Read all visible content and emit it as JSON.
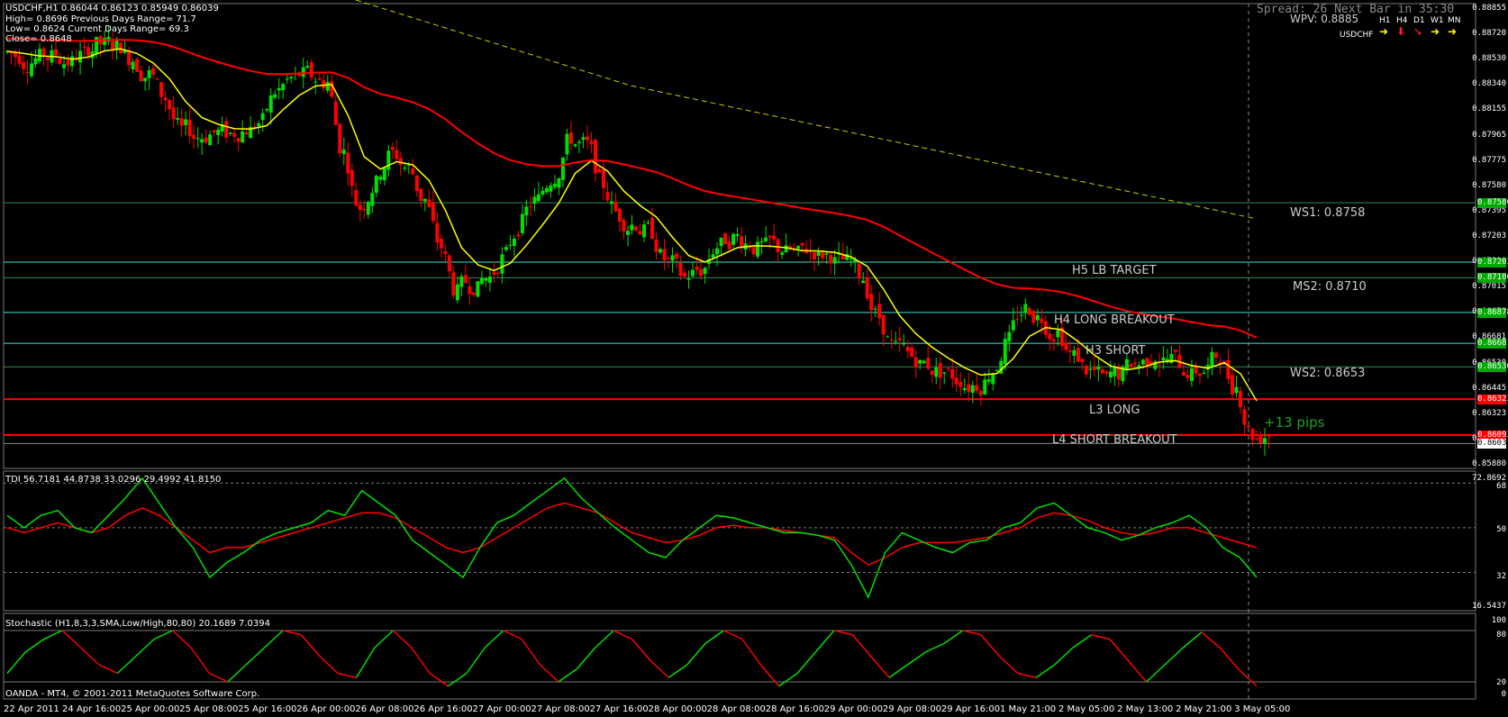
{
  "main": {
    "symbol_line": "USDCHF,H1  0.86044 0.86123 0.85949 0.86039",
    "info_lines": [
      "High= 0.8696   Previous Days Range= 71.7",
      "Low= 0.8624    Current Days Range= 69.3",
      "Close= 0.8648"
    ],
    "spread_text": "Spread: 26   Next Bar in 35:30",
    "wpv": "WPV: 0.8885",
    "tf_labels": [
      "H1",
      "H4",
      "D1",
      "W1",
      "MN"
    ],
    "tf_symbol": "USDCHF",
    "tf_arrows": [
      {
        "glyph": "➜",
        "color": "#ffff00"
      },
      {
        "glyph": "⬇",
        "color": "#ff2020"
      },
      {
        "glyph": "➘",
        "color": "#ff2020"
      },
      {
        "glyph": "➜",
        "color": "#ffff00"
      },
      {
        "glyph": "➜",
        "color": "#ffff00"
      }
    ],
    "price_axis": [
      "0.88855",
      "0.88720",
      "0.88530",
      "0.88340",
      "0.88155",
      "0.87965",
      "0.87775",
      "0.87580",
      "0.87395",
      "0.87203",
      "0.87100",
      "0.87015",
      "0.86878",
      "0.86681",
      "0.86530",
      "0.86445",
      "0.86323",
      "0.86039",
      "0.85880"
    ],
    "level_lines": [
      {
        "name": "WS1",
        "price": 0.8758,
        "color": "#2e8b57",
        "tag": "0.87580",
        "tag_color": "#00aa00"
      },
      {
        "name": "H5",
        "price": 0.872,
        "color": "#40e0d0",
        "tag": "0.87203",
        "tag_color": "#00aa00"
      },
      {
        "name": "MS2",
        "price": 0.871,
        "color": "#2e8b57",
        "tag": "0.87100",
        "tag_color": "#00aa00"
      },
      {
        "name": "H4",
        "price": 0.86878,
        "color": "#40e0d0",
        "tag": "0.86878",
        "tag_color": "#00aa00"
      },
      {
        "name": "H3",
        "price": 0.86681,
        "color": "#40e0d0",
        "tag": "0.86681",
        "tag_color": "#00aa00"
      },
      {
        "name": "WS2",
        "price": 0.8653,
        "color": "#2e8b57",
        "tag": "0.86530",
        "tag_color": "#00aa00"
      },
      {
        "name": "L3",
        "price": 0.86323,
        "color": "#ff0000",
        "tag": "0.86323",
        "tag_color": "#ff0000"
      },
      {
        "name": "L4",
        "price": 0.86093,
        "color": "#ff0000",
        "tag": "0.86093",
        "tag_color": "#ff0000"
      },
      {
        "name": "cur",
        "price": 0.86039,
        "color": "#888888",
        "tag": "0.86039",
        "tag_color": "#ffffff"
      }
    ],
    "annotations": {
      "ws1": "WS1:  0.8758",
      "h5": "H5 LB TARGET",
      "ms2": "MS2:  0.8710",
      "h4": "H4 LONG BREAKOUT",
      "h3": "H3 SHORT",
      "ws2": "WS2:  0.8653",
      "l3": "L3 LONG",
      "pips": "+13 pips",
      "l4": "L4 SHORT BREAKOUT"
    }
  },
  "tdi": {
    "header": "TDI 56.7181 44.8738 33.0296 29.4992 41.8150",
    "axis": [
      "72.8692",
      "68",
      "50",
      "32",
      "16.5437"
    ]
  },
  "stoch": {
    "header": "Stochastic (H1,8,3,3,SMA,Low/High,80,80) 20.1689 7.0394",
    "axis": [
      "100",
      "80",
      "20",
      "0"
    ],
    "footer": "OANDA - MT4, © 2001-2011 MetaQuotes Software Corp."
  },
  "date_axis": [
    "22 Apr 2011",
    "24 Apr 16:00",
    "25 Apr 00:00",
    "25 Apr 08:00",
    "25 Apr 16:00",
    "26 Apr 00:00",
    "26 Apr 08:00",
    "26 Apr 16:00",
    "27 Apr 00:00",
    "27 Apr 08:00",
    "27 Apr 16:00",
    "28 Apr 00:00",
    "28 Apr 08:00",
    "28 Apr 16:00",
    "29 Apr 00:00",
    "29 Apr 08:00",
    "29 Apr 16:00",
    "1 May 21:00",
    "2 May 05:00",
    "2 May 13:00",
    "2 May 21:00",
    "3 May 05:00"
  ],
  "chart_data": {
    "type": "candlestick",
    "symbol": "USDCHF",
    "timeframe": "H1",
    "ylim": [
      0.8588,
      0.88855
    ],
    "close_trace": [
      0.8855,
      0.8852,
      0.885,
      0.8851,
      0.8848,
      0.8853,
      0.886,
      0.8858,
      0.885,
      0.884,
      0.8825,
      0.8805,
      0.88,
      0.8803,
      0.8802,
      0.8805,
      0.881,
      0.883,
      0.8838,
      0.884,
      0.8835,
      0.879,
      0.8755,
      0.877,
      0.879,
      0.878,
      0.876,
      0.873,
      0.87,
      0.8705,
      0.871,
      0.8725,
      0.8745,
      0.876,
      0.8775,
      0.88,
      0.8795,
      0.877,
      0.875,
      0.8745,
      0.874,
      0.872,
      0.871,
      0.8715,
      0.873,
      0.8735,
      0.8732,
      0.873,
      0.8728,
      0.8725,
      0.8727,
      0.8725,
      0.872,
      0.871,
      0.8685,
      0.8665,
      0.866,
      0.8655,
      0.865,
      0.8645,
      0.8642,
      0.865,
      0.867,
      0.869,
      0.8685,
      0.8675,
      0.866,
      0.865,
      0.8645,
      0.8648,
      0.8655,
      0.866,
      0.8658,
      0.865,
      0.865,
      0.866,
      0.864,
      0.861
    ],
    "tdi_green": [
      55,
      50,
      55,
      57,
      50,
      48,
      55,
      62,
      70,
      60,
      50,
      42,
      30,
      36,
      40,
      45,
      48,
      50,
      52,
      57,
      55,
      65,
      60,
      55,
      45,
      40,
      35,
      30,
      42,
      52,
      55,
      60,
      65,
      70,
      62,
      56,
      50,
      45,
      40,
      38,
      45,
      50,
      55,
      54,
      52,
      50,
      48,
      48,
      47,
      45,
      35,
      22,
      40,
      48,
      45,
      42,
      40,
      44,
      45,
      50,
      52,
      58,
      60,
      55,
      50,
      48,
      45,
      47,
      50,
      52,
      55,
      50,
      42,
      38,
      30
    ],
    "tdi_red": [
      50,
      48,
      50,
      52,
      50,
      48,
      50,
      55,
      58,
      55,
      50,
      45,
      40,
      42,
      42,
      44,
      46,
      48,
      50,
      52,
      54,
      56,
      56,
      54,
      50,
      46,
      42,
      40,
      42,
      46,
      50,
      54,
      58,
      60,
      58,
      56,
      52,
      48,
      46,
      44,
      45,
      47,
      50,
      51,
      50,
      50,
      49,
      48,
      47,
      46,
      40,
      35,
      38,
      42,
      44,
      44,
      44,
      45,
      46,
      48,
      50,
      54,
      56,
      55,
      53,
      50,
      48,
      47,
      48,
      50,
      50,
      48,
      46,
      44,
      42
    ],
    "stoch": [
      30,
      55,
      70,
      80,
      60,
      40,
      30,
      50,
      70,
      80,
      60,
      30,
      20,
      40,
      60,
      80,
      75,
      50,
      30,
      25,
      60,
      80,
      60,
      30,
      15,
      30,
      60,
      80,
      70,
      40,
      20,
      35,
      60,
      80,
      70,
      45,
      25,
      40,
      65,
      80,
      70,
      40,
      15,
      30,
      55,
      80,
      75,
      50,
      25,
      40,
      55,
      65,
      80,
      75,
      50,
      30,
      25,
      40,
      60,
      75,
      70,
      45,
      20,
      40,
      60,
      78,
      60,
      35,
      15
    ]
  }
}
